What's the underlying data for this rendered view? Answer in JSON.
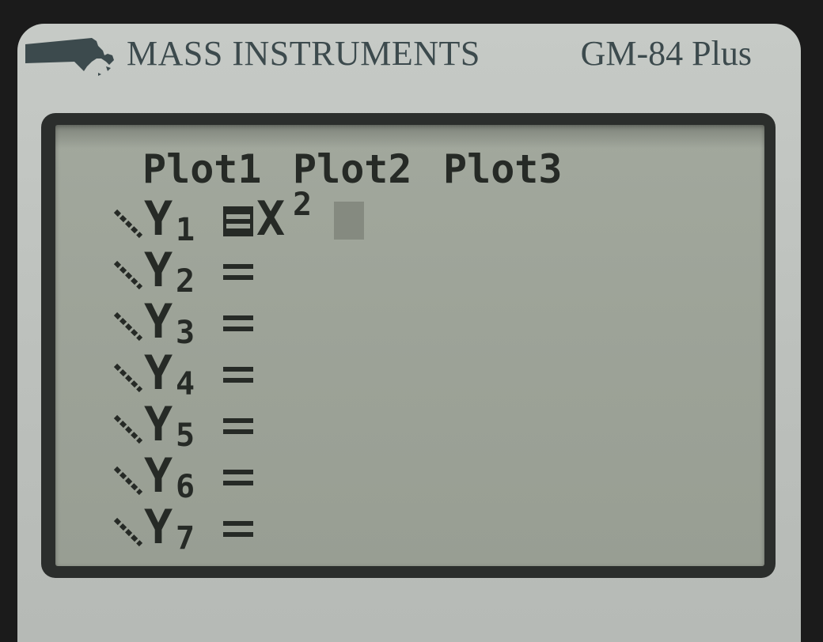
{
  "header": {
    "brand": "MASS INSTRUMENTS",
    "model": "GM-84 Plus"
  },
  "screen": {
    "plots": [
      "Plot1",
      "Plot2",
      "Plot3"
    ],
    "y_vars": [
      {
        "name": "Y",
        "sub": "1",
        "expression": "X",
        "exponent": "2",
        "selected": true
      },
      {
        "name": "Y",
        "sub": "2",
        "expression": "",
        "selected": false
      },
      {
        "name": "Y",
        "sub": "3",
        "expression": "",
        "selected": false
      },
      {
        "name": "Y",
        "sub": "4",
        "expression": "",
        "selected": false
      },
      {
        "name": "Y",
        "sub": "5",
        "expression": "",
        "selected": false
      },
      {
        "name": "Y",
        "sub": "6",
        "expression": "",
        "selected": false
      },
      {
        "name": "Y",
        "sub": "7",
        "expression": "",
        "selected": false
      }
    ]
  },
  "colors": {
    "lcd_background": "#9da398",
    "lcd_text": "#262a26",
    "bezel": "#c2c6c2",
    "brand_text": "#3c4a4d"
  },
  "icons": {
    "logo": "massachusetts-map-icon",
    "graph_style": "line-style-icon",
    "cursor": "blinking-cursor-block"
  }
}
